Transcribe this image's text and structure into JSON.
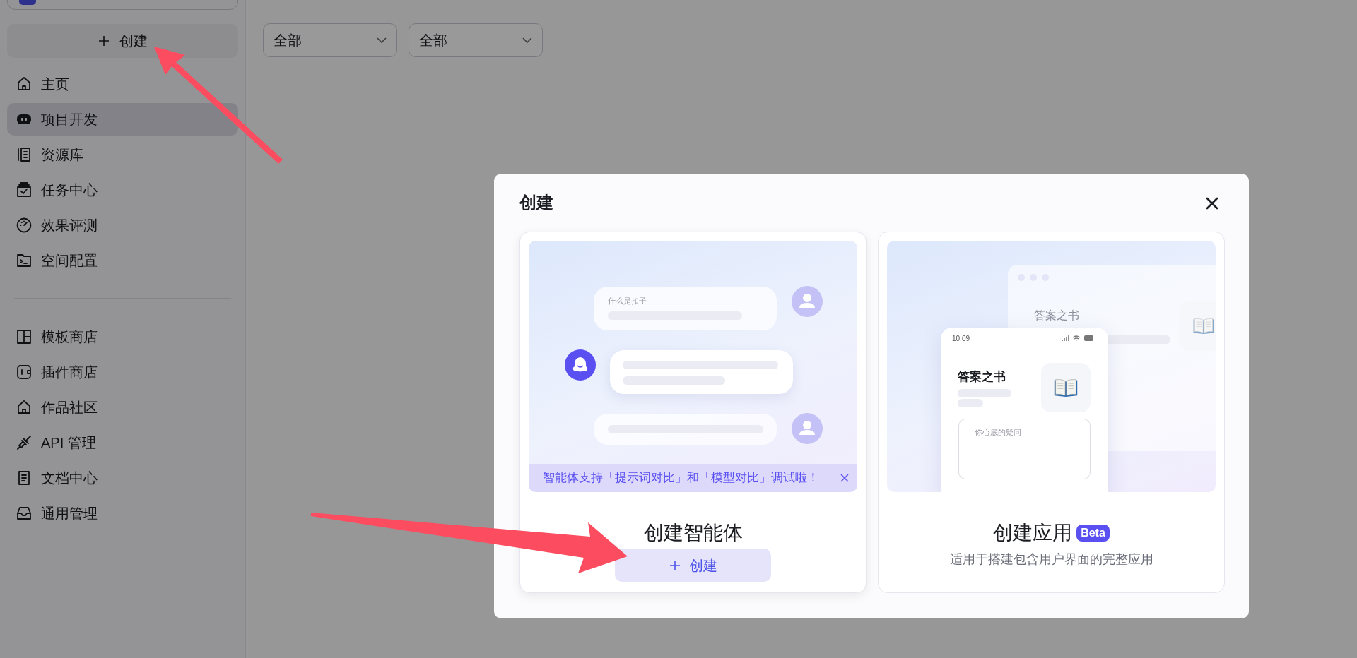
{
  "sidebar": {
    "create_button": {
      "label": "创建"
    },
    "nav_groups": [
      [
        {
          "label": "主页",
          "selected": false
        },
        {
          "label": "项目开发",
          "selected": true
        },
        {
          "label": "资源库",
          "selected": false
        },
        {
          "label": "任务中心",
          "selected": false
        },
        {
          "label": "效果评测",
          "selected": false
        },
        {
          "label": "空间配置",
          "selected": false
        }
      ],
      [
        {
          "label": "模板商店",
          "selected": false
        },
        {
          "label": "插件商店",
          "selected": false
        },
        {
          "label": "作品社区",
          "selected": false
        },
        {
          "label": "API 管理",
          "selected": false
        },
        {
          "label": "文档中心",
          "selected": false
        },
        {
          "label": "通用管理",
          "selected": false
        }
      ]
    ]
  },
  "filters": [
    {
      "value": "全部"
    },
    {
      "value": "全部"
    }
  ],
  "modal": {
    "title": "创建",
    "cards": [
      {
        "kind": "agent",
        "illustration": {
          "question": "什么是扣子"
        },
        "banner": "智能体支持「提示词对比」和「模型对比」调试啦！",
        "title": "创建智能体",
        "button": {
          "label": "创建"
        }
      },
      {
        "kind": "app",
        "illustration": {
          "window_title": "答案之书",
          "phone_time": "10:09",
          "phone_title": "答案之书",
          "input_placeholder": "你心底的疑问"
        },
        "title": "创建应用",
        "badge": "Beta",
        "description": "适用于搭建包含用户界面的完整应用"
      }
    ]
  }
}
